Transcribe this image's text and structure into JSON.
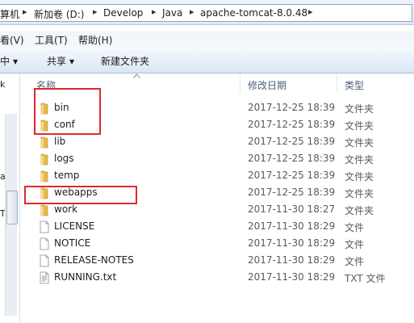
{
  "address": {
    "crumbs": [
      "算机",
      "新加卷 (D:)",
      "Develop",
      "Java",
      "apache-tomcat-8.0.48"
    ]
  },
  "menu": [
    "看(V)",
    "工具(T)",
    "帮助(H)"
  ],
  "toolbar": {
    "organize_partial": "中",
    "share": "共享",
    "new_folder": "新建文件夹"
  },
  "nav_fragments": [
    "k",
    "av",
    "T."
  ],
  "columns": {
    "name": "名称",
    "date": "修改日期",
    "type": "类型"
  },
  "files": [
    {
      "name": "bin",
      "date": "2017-12-25 18:39",
      "type": "文件夹",
      "kind": "folder"
    },
    {
      "name": "conf",
      "date": "2017-12-25 18:39",
      "type": "文件夹",
      "kind": "folder"
    },
    {
      "name": "lib",
      "date": "2017-12-25 18:39",
      "type": "文件夹",
      "kind": "folder"
    },
    {
      "name": "logs",
      "date": "2017-12-25 18:39",
      "type": "文件夹",
      "kind": "folder"
    },
    {
      "name": "temp",
      "date": "2017-12-25 18:39",
      "type": "文件夹",
      "kind": "folder"
    },
    {
      "name": "webapps",
      "date": "2017-12-25 18:39",
      "type": "文件夹",
      "kind": "folder"
    },
    {
      "name": "work",
      "date": "2017-11-30 18:27",
      "type": "文件夹",
      "kind": "folder"
    },
    {
      "name": "LICENSE",
      "date": "2017-11-30 18:29",
      "type": "文件",
      "kind": "file"
    },
    {
      "name": "NOTICE",
      "date": "2017-11-30 18:29",
      "type": "文件",
      "kind": "file"
    },
    {
      "name": "RELEASE-NOTES",
      "date": "2017-11-30 18:29",
      "type": "文件",
      "kind": "file"
    },
    {
      "name": "RUNNING.txt",
      "date": "2017-11-30 18:29",
      "type": "TXT 文件",
      "kind": "text"
    }
  ],
  "colors": {
    "highlight": "#e0282c",
    "folder": "#e8b84a"
  }
}
